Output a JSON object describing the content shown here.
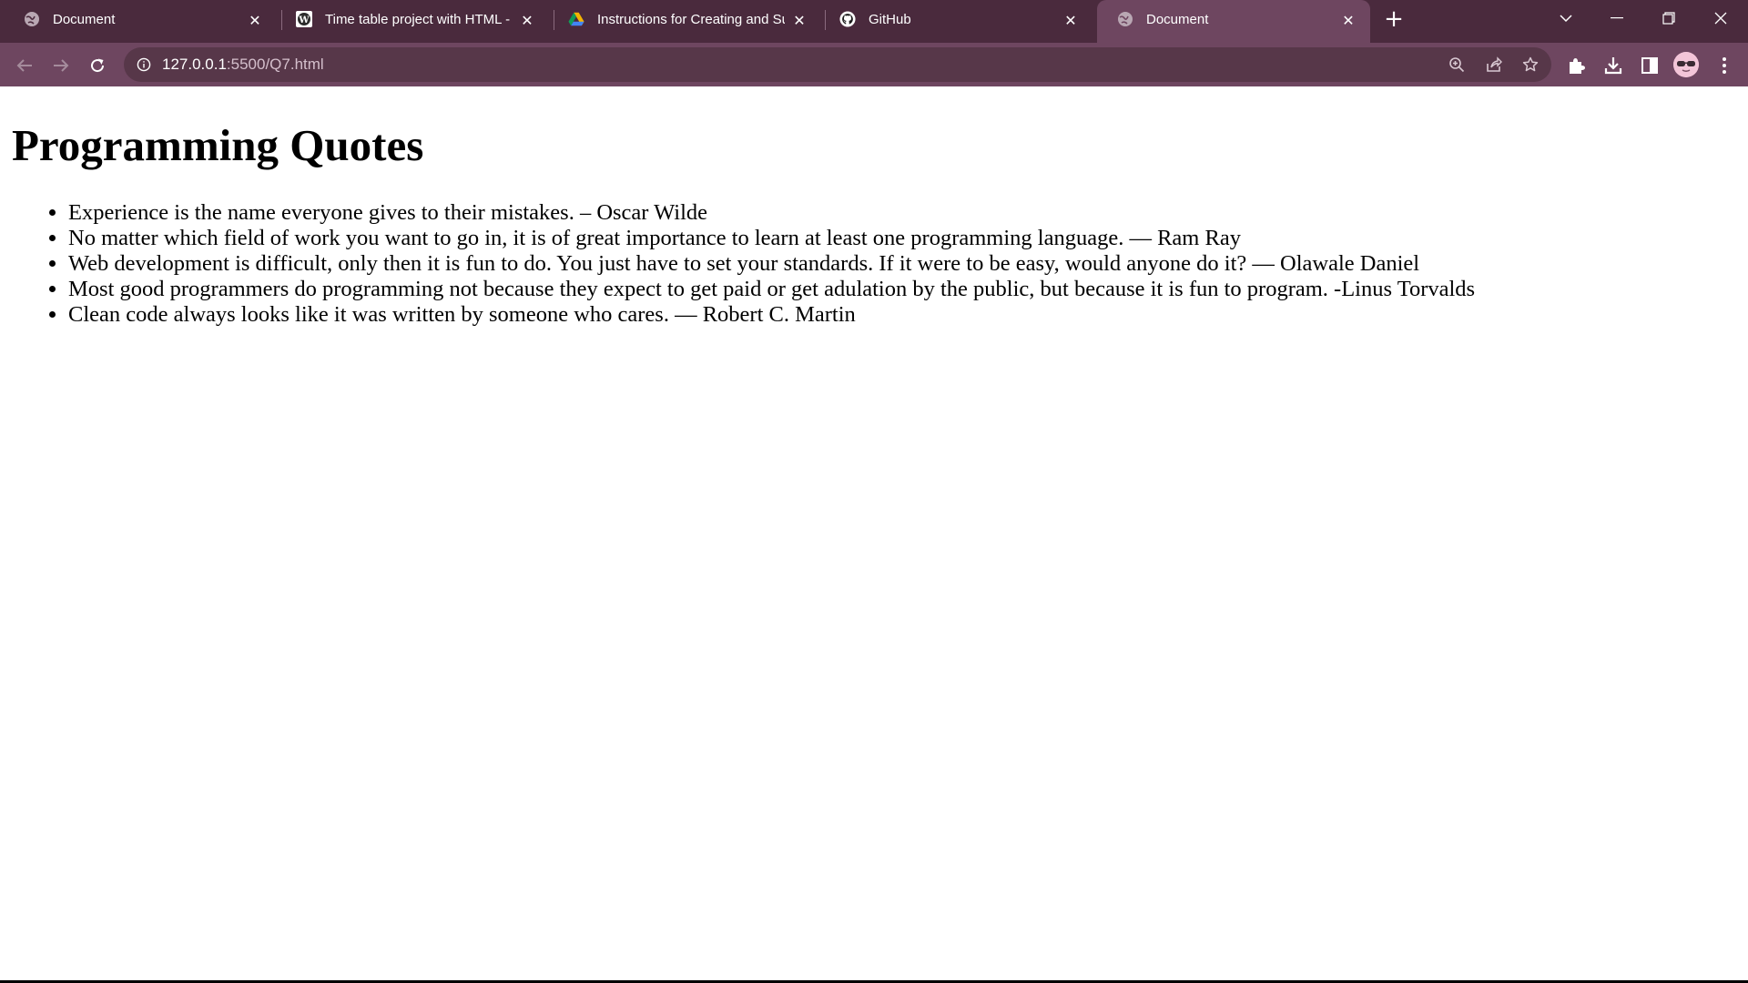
{
  "browser": {
    "tabs": [
      {
        "title": "Document",
        "icon": "globe-icon",
        "active": false
      },
      {
        "title": "Time table project with HTML - I",
        "icon": "wordpress-icon",
        "active": false
      },
      {
        "title": "Instructions for Creating and Sul",
        "icon": "google-drive-icon",
        "active": false
      },
      {
        "title": "GitHub",
        "icon": "github-icon",
        "active": false
      },
      {
        "title": "Document",
        "icon": "globe-icon",
        "active": true
      }
    ],
    "new_tab_label": "+",
    "address": {
      "host": "127.0.0.1",
      "rest": ":5500/Q7.html"
    },
    "colors": {
      "tabstrip": "#4a2a3d",
      "toolbar": "#6e4660",
      "omnibox": "#573749"
    }
  },
  "page": {
    "heading": "Programming Quotes",
    "quotes": [
      "Experience is the name everyone gives to their mistakes. – Oscar Wilde",
      "No matter which field of work you want to go in, it is of great importance to learn at least one programming language. — Ram Ray",
      "Web development is difficult, only then it is fun to do. You just have to set your standards. If it were to be easy, would anyone do it? — Olawale Daniel",
      "Most good programmers do programming not because they expect to get paid or get adulation by the public, but because it is fun to program. -Linus Torvalds",
      "Clean code always looks like it was written by someone who cares. — Robert C. Martin"
    ]
  }
}
